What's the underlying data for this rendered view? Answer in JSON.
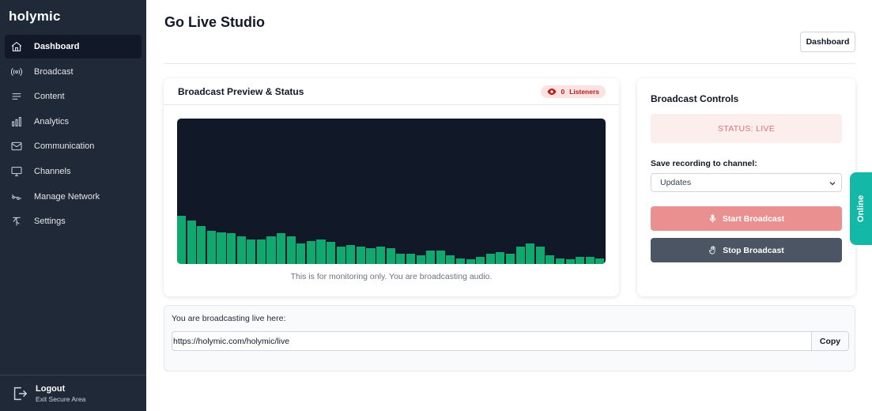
{
  "app": {
    "brand": "holymic"
  },
  "sidebar": {
    "items": [
      {
        "label": "Dashboard",
        "icon": "home-icon",
        "active": true
      },
      {
        "label": "Broadcast",
        "icon": "broadcast-icon",
        "active": false
      },
      {
        "label": "Content",
        "icon": "menu-lines-icon",
        "active": false
      },
      {
        "label": "Analytics",
        "icon": "bar-chart-icon",
        "active": false
      },
      {
        "label": "Communication",
        "icon": "mail-icon",
        "active": false
      },
      {
        "label": "Channels",
        "icon": "monitor-icon",
        "active": false
      },
      {
        "label": "Manage Network",
        "icon": "network-icon",
        "active": false
      },
      {
        "label": "Settings",
        "icon": "antenna-icon",
        "active": false
      }
    ],
    "footer": {
      "title": "Logout",
      "subtitle": "Exit Secure Area",
      "icon": "logout-icon"
    }
  },
  "header": {
    "title": "Go Live Studio",
    "button_label": "Dashboard"
  },
  "preview": {
    "title": "Broadcast Preview & Status",
    "listeners_count": "0",
    "listeners_label": "Listeners",
    "note": "This is for monitoring only. You are broadcasting audio.",
    "levels": [
      0.33,
      0.3,
      0.26,
      0.23,
      0.22,
      0.21,
      0.19,
      0.17,
      0.17,
      0.19,
      0.21,
      0.19,
      0.14,
      0.16,
      0.17,
      0.15,
      0.12,
      0.13,
      0.12,
      0.11,
      0.12,
      0.11,
      0.07,
      0.07,
      0.06,
      0.09,
      0.09,
      0.06,
      0.04,
      0.03,
      0.05,
      0.07,
      0.08,
      0.07,
      0.12,
      0.14,
      0.12,
      0.06,
      0.04,
      0.03,
      0.05,
      0.05,
      0.04
    ]
  },
  "controls": {
    "title": "Broadcast Controls",
    "status": "STATUS: LIVE",
    "save_label": "Save recording to channel:",
    "select_value": "Updates",
    "start_label": "Start Broadcast",
    "stop_label": "Stop Broadcast"
  },
  "online_tab": {
    "label": "Online"
  },
  "live": {
    "label": "You are broadcasting live here:",
    "url": "https://holymic.com/holymic/live",
    "copy_label": "Copy"
  },
  "colors": {
    "sidebar_bg": "#1f2937",
    "viz_bar": "#10a86e",
    "status_text": "#e07070",
    "online_tab": "#14b8a6"
  }
}
